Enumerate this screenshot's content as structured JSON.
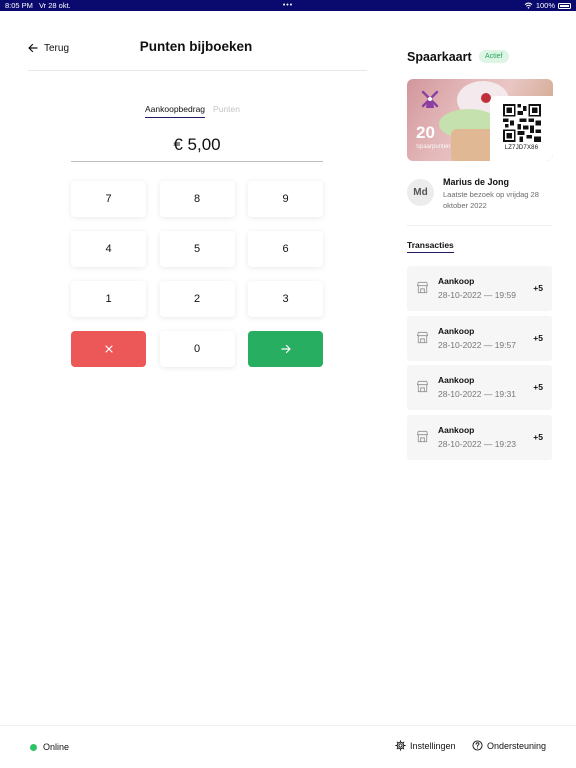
{
  "status_bar": {
    "time": "8:05 PM",
    "date": "Vr 28 okt.",
    "dots": "•••",
    "battery": "100%"
  },
  "header": {
    "back_label": "Terug",
    "title": "Punten bijboeken"
  },
  "tabs": [
    {
      "label": "Aankoopbedrag",
      "active": true
    },
    {
      "label": "Punten",
      "active": false
    }
  ],
  "amount": "€ 5,00",
  "keypad": {
    "keys": [
      "7",
      "8",
      "9",
      "4",
      "5",
      "6",
      "1",
      "2",
      "3"
    ],
    "zero": "0",
    "clear_icon": "close-icon",
    "confirm_icon": "arrow-right-icon"
  },
  "card": {
    "title": "Spaarkaart",
    "status": "Actief",
    "points": "20",
    "points_label": "Spaarpunten",
    "code": "LZ7JD7X86",
    "logo_icon": "windmill-icon"
  },
  "customer": {
    "initials": "Md",
    "name": "Marius de Jong",
    "last_visit": "Laatste bezoek op vrijdag 28 oktober 2022"
  },
  "transactions": {
    "heading": "Transacties",
    "items": [
      {
        "title": "Aankoop",
        "date": "28-10-2022 — 19:59",
        "points": "+5"
      },
      {
        "title": "Aankoop",
        "date": "28-10-2022 — 19:57",
        "points": "+5"
      },
      {
        "title": "Aankoop",
        "date": "28-10-2022 — 19:31",
        "points": "+5"
      },
      {
        "title": "Aankoop",
        "date": "28-10-2022 — 19:23",
        "points": "+5"
      }
    ]
  },
  "footer": {
    "status": "Online",
    "settings_label": "Instellingen",
    "support_label": "Ondersteuning"
  },
  "colors": {
    "accent": "#1f1a66",
    "status_bar": "#0a0a6e",
    "clear": "#ec5757",
    "confirm": "#27ae60",
    "online": "#2ec466",
    "badge_bg": "#dcf5e5",
    "badge_text": "#2aa35b"
  }
}
